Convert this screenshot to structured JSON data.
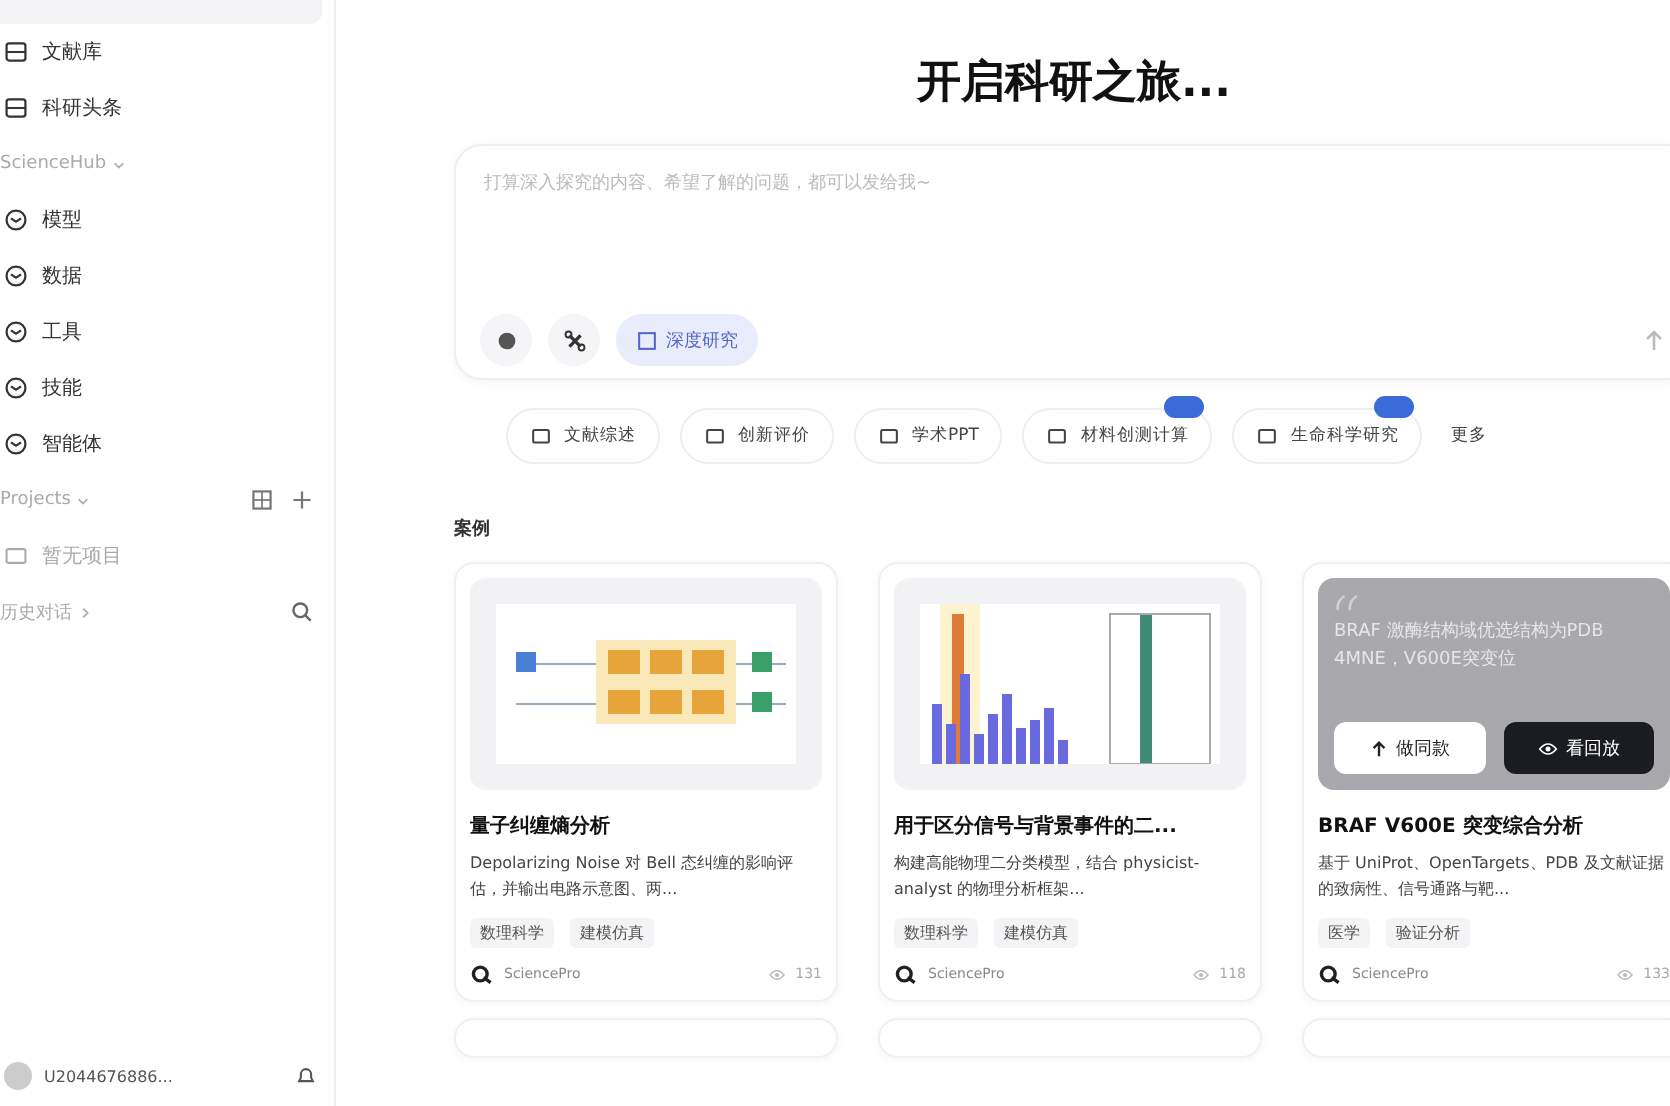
{
  "sidebar": {
    "nav_items": [
      {
        "label": "文献库"
      },
      {
        "label": "科研头条"
      }
    ],
    "sections": [
      {
        "title": "ScienceHub",
        "items": [
          {
            "label": "模型"
          },
          {
            "label": "数据"
          },
          {
            "label": "工具"
          },
          {
            "label": "技能"
          },
          {
            "label": "智能体"
          }
        ]
      }
    ],
    "projects": {
      "title": "Projects",
      "empty": "暂无项目"
    },
    "history": {
      "title": "历史对话"
    },
    "user": {
      "name": "U2044676886..."
    }
  },
  "main": {
    "title": "开启科研之旅...",
    "composer": {
      "placeholder": "打算深入探究的内容、希望了解的问题，都可以发给我~",
      "mode_chip": {
        "label": "深度研究",
        "selected": true
      }
    },
    "quick_actions": [
      {
        "label": "文献综述",
        "badge": false
      },
      {
        "label": "创新评价",
        "badge": false
      },
      {
        "label": "学术PPT",
        "badge": false
      },
      {
        "label": "材料创测计算",
        "badge": true
      },
      {
        "label": "生命科学研究",
        "badge": true
      },
      {
        "label": "更多",
        "badge": false
      }
    ],
    "section_title": "案例",
    "cases": [
      {
        "kind": "circuit",
        "title": "量子纠缠熵分析",
        "description": "Depolarizing Noise 对 Bell 态纠缠的影响评估，并输出电路示意图、两...",
        "tags": [
          "数理科学",
          "建模仿真"
        ],
        "author": "SciencePro",
        "views": "131"
      },
      {
        "kind": "histogram",
        "title": "用于区分信号与背景事件的二...",
        "description": "构建高能物理二分类模型，结合 physicist-analyst 的物理分析框架...",
        "tags": [
          "数理科学",
          "建模仿真"
        ],
        "author": "SciencePro",
        "views": "118"
      },
      {
        "kind": "quote",
        "title": "BRAF V600E 突变综合分析",
        "description": "基于 UniProt、OpenTargets、PDB 及文献证据的致病性、信号通路与靶...",
        "tags": [
          "医学",
          "验证分析"
        ],
        "author": "SciencePro",
        "views": "133",
        "quote": "BRAF 激酶结构域优选结构为PDB 4MNE，V600E突变位",
        "hover_buttons": [
          "做同款",
          "看回放"
        ]
      }
    ]
  }
}
